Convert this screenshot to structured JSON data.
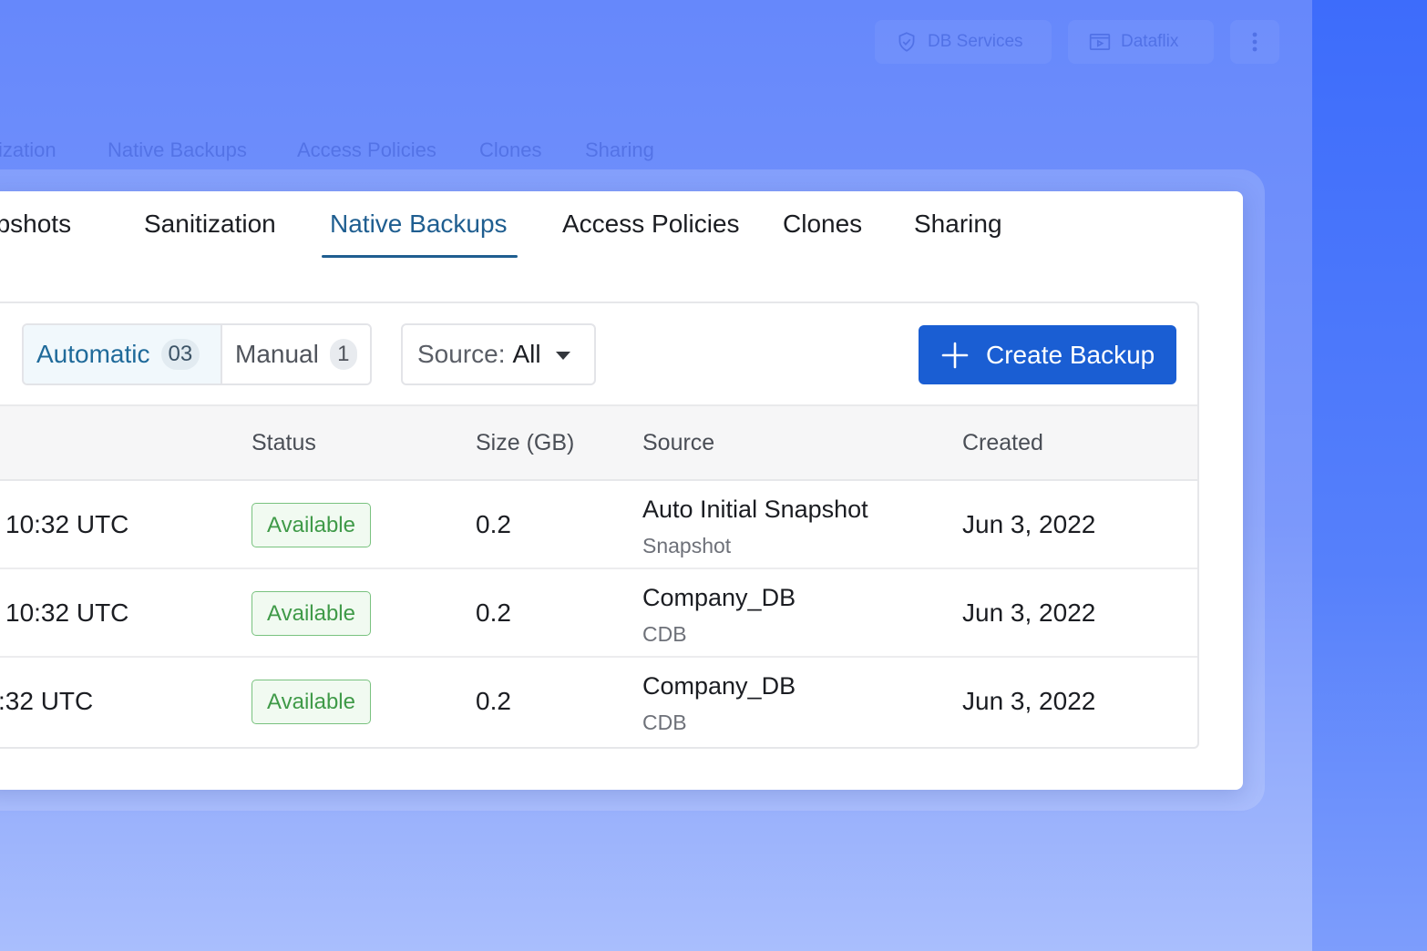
{
  "header": {
    "db_services_label": "DB Services",
    "dataflix_label": "Dataflix",
    "more_icon": "vertical-dots-icon"
  },
  "background_tabs": [
    "ization",
    "Native Backups",
    "Access Policies",
    "Clones",
    "Sharing"
  ],
  "tabs": [
    {
      "label": "apshots"
    },
    {
      "label": "Sanitization"
    },
    {
      "label": "Native Backups"
    },
    {
      "label": "Access Policies"
    },
    {
      "label": "Clones"
    },
    {
      "label": "Sharing"
    }
  ],
  "active_tab": "Native Backups",
  "filters": {
    "automatic_label": "Automatic",
    "automatic_count": "03",
    "manual_label": "Manual",
    "manual_count": "1",
    "source_prefix": "Source:",
    "source_value": "All"
  },
  "create_button_label": "Create Backup",
  "table": {
    "columns": [
      "Status",
      "Size (GB)",
      "Source",
      "Created"
    ],
    "rows": [
      {
        "time": "10:32 UTC",
        "status": "Available",
        "size": "0.2",
        "source": "Auto Initial Snapshot",
        "source_type": "Snapshot",
        "created": "Jun 3, 2022"
      },
      {
        "time": "10:32 UTC",
        "status": "Available",
        "size": "0.2",
        "source": "Company_DB",
        "source_type": "CDB",
        "created": "Jun 3, 2022"
      },
      {
        "time": ":32 UTC",
        "status": "Available",
        "size": "0.2",
        "source": "Company_DB",
        "source_type": "CDB",
        "created": "Jun 3, 2022"
      }
    ]
  },
  "colors": {
    "accent": "#1a5ed3",
    "active_tab": "#1f5e90",
    "status_available": "#3f9a48",
    "background": "#6688fb"
  }
}
